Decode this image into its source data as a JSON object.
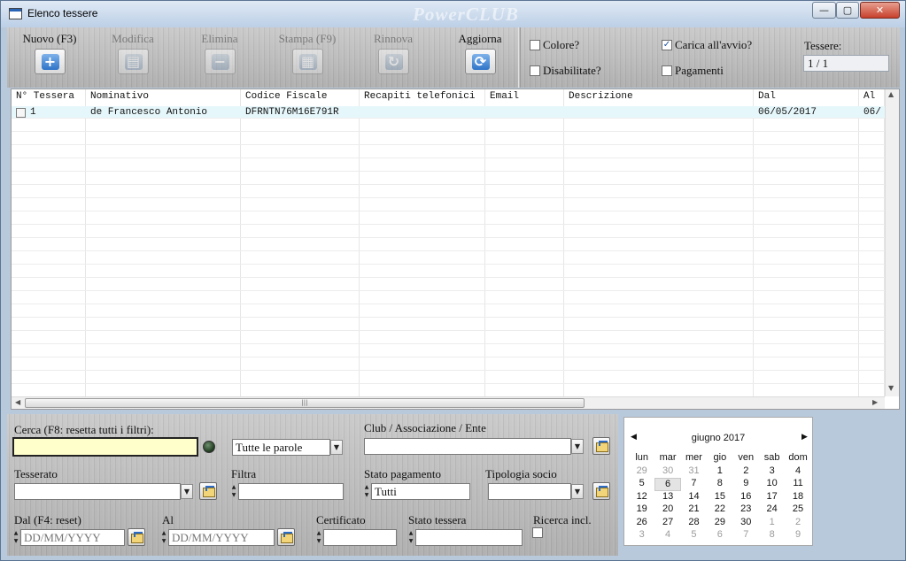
{
  "window": {
    "title": "Elenco tessere",
    "watermark": "PowerCLUB",
    "buttons": {
      "minimize": "—",
      "maximize": "▢",
      "close": "✕"
    }
  },
  "toolbar": {
    "new_label": "Nuovo (F3)",
    "edit_label": "Modifica",
    "delete_label": "Elimina",
    "print_label": "Stampa (F9)",
    "renew_label": "Rinnova",
    "refresh_label": "Aggiorna",
    "icons": {
      "new": "+",
      "edit": "▤",
      "delete": "−",
      "print": "▦",
      "renew": "↻",
      "refresh": "⟳"
    }
  },
  "options": {
    "colore": {
      "label": "Colore?",
      "checked": false
    },
    "carica": {
      "label": "Carica all'avvio?",
      "checked": true
    },
    "disabilitate": {
      "label": "Disabilitate?",
      "checked": false
    },
    "pagamenti": {
      "label": "Pagamenti",
      "checked": false
    },
    "tessere_label": "Tessere:",
    "tessere_value": "1 / 1"
  },
  "grid": {
    "columns": [
      "N° Tessera",
      "Nominativo",
      "Codice Fiscale",
      "Recapiti telefonici",
      "Email",
      "Descrizione",
      "Dal",
      "Al"
    ],
    "rows": [
      [
        "1",
        "de Francesco Antonio",
        "DFRNTN76M16E791R",
        "",
        "",
        "",
        "06/05/2017",
        "06/"
      ]
    ]
  },
  "filters": {
    "cerca_label": "Cerca (F8: resetta tutti i filtri):",
    "cerca_value": "",
    "mode_value": "Tutte le parole",
    "club_label": "Club / Associazione / Ente",
    "club_value": "",
    "tesserato_label": "Tesserato",
    "tesserato_value": "",
    "filtra_label": "Filtra",
    "filtra_value": "",
    "stato_pag_label": "Stato pagamento",
    "stato_pag_value": "Tutti",
    "tipologia_label": "Tipologia socio",
    "tipologia_value": "",
    "dal_label": "Dal (F4: reset)",
    "dal_placeholder": "DD/MM/YYYY",
    "al_label": "Al",
    "al_placeholder": "DD/MM/YYYY",
    "certificato_label": "Certificato",
    "certificato_value": "",
    "stato_tessera_label": "Stato tessera",
    "stato_tessera_value": "",
    "ricerca_label": "Ricerca incl."
  },
  "calendar": {
    "month": "giugno 2017",
    "prev": "◀",
    "next": "▶",
    "weekdays": [
      "lun",
      "mar",
      "mer",
      "gio",
      "ven",
      "sab",
      "dom"
    ],
    "weeks": [
      [
        "29",
        "30",
        "31",
        "1",
        "2",
        "3",
        "4"
      ],
      [
        "5",
        "6",
        "7",
        "8",
        "9",
        "10",
        "11"
      ],
      [
        "12",
        "13",
        "14",
        "15",
        "16",
        "17",
        "18"
      ],
      [
        "19",
        "20",
        "21",
        "22",
        "23",
        "24",
        "25"
      ],
      [
        "26",
        "27",
        "28",
        "29",
        "30",
        "1",
        "2"
      ],
      [
        "3",
        "4",
        "5",
        "6",
        "7",
        "8",
        "9"
      ]
    ],
    "today": "6"
  }
}
